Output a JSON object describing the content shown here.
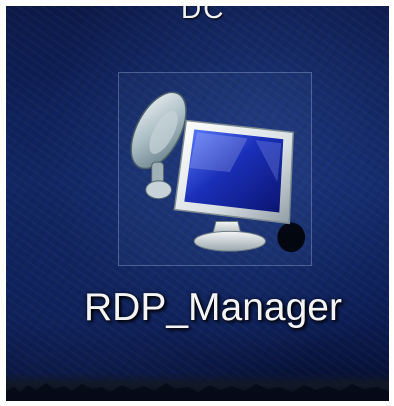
{
  "desktop": {
    "partial_label_above": "DC",
    "icon": {
      "label": "RDP_Manager",
      "icon_name": "remote-desktop-monitor-satellite-dish-icon"
    }
  },
  "colors": {
    "wallpaper": "#102563",
    "label_text": "#f4f4f4",
    "monitor_screen": "#1a2fb8"
  }
}
